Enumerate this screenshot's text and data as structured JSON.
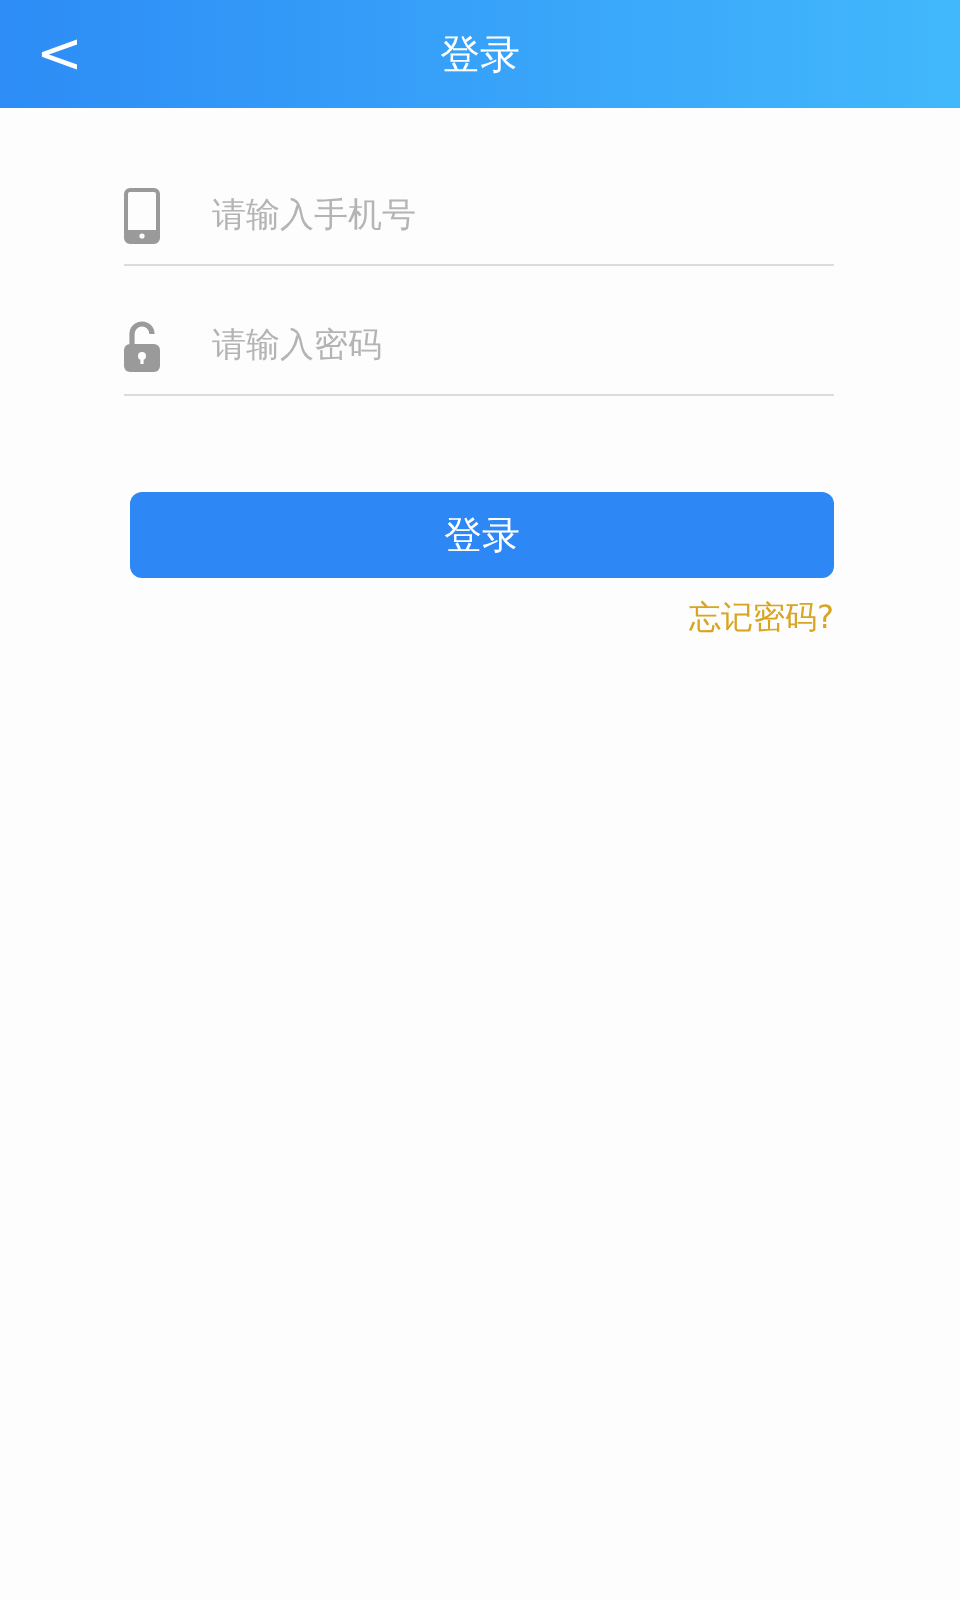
{
  "header": {
    "back": "<",
    "title": "登录"
  },
  "fields": [
    {
      "kind": "phone",
      "placeholder": "请输入手机号"
    },
    {
      "kind": "password",
      "placeholder": "请输入密码"
    }
  ],
  "login_button": "登录",
  "forgot_link": "忘记密码?"
}
